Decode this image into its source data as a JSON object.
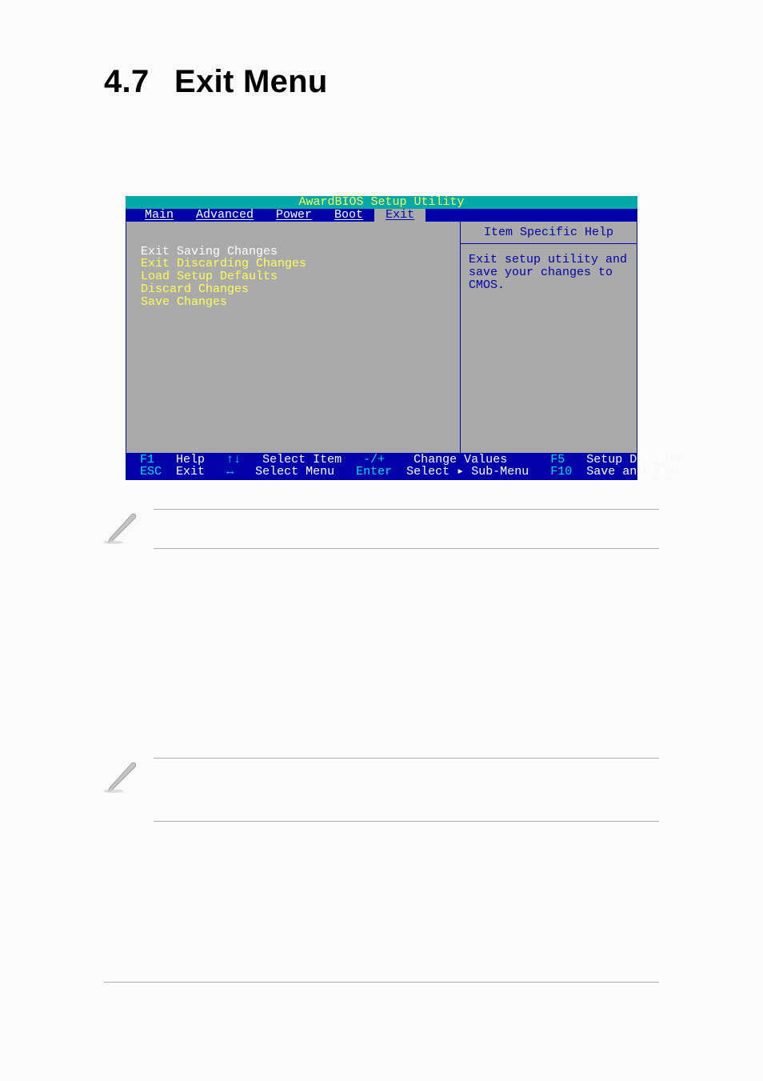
{
  "heading": {
    "num": "4.7",
    "title": "Exit Menu"
  },
  "bios": {
    "title": "AwardBIOS Setup Utility",
    "tabs": [
      "Main",
      "Advanced",
      "Power",
      "Boot",
      "Exit"
    ],
    "active_tab": "Exit",
    "menu_items": [
      "Exit Saving Changes",
      "Exit Discarding Changes",
      "Load Setup Defaults",
      "Discard Changes",
      "Save Changes"
    ],
    "selected_index": 0,
    "help_title": "Item Specific Help",
    "help_text": "Exit setup utility and save your changes to CMOS.",
    "footer": {
      "r1": {
        "k1": "F1",
        "l1": "Help",
        "k2": "↑↓",
        "l2": "Select Item",
        "k3": "-/+",
        "l3": "Change Values",
        "k4": "F5",
        "l4": "Setup Defaults"
      },
      "r2": {
        "k1": "ESC",
        "l1": "Exit",
        "k2": "↔",
        "l2": "Select Menu",
        "k3": "Enter",
        "l3": "Select ▸ Sub-Menu",
        "k4": "F10",
        "l4": "Save and Exit"
      }
    }
  }
}
